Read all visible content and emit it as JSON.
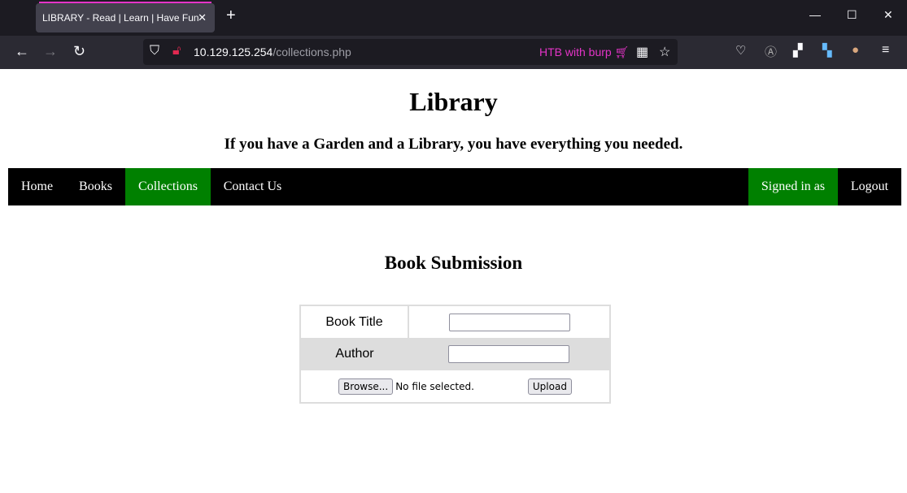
{
  "browser": {
    "tab_title": "LIBRARY - Read | Learn | Have Fun",
    "url_host": "10.129.125.254",
    "url_path": "/collections.php",
    "extension_label": "HTB with burp"
  },
  "header": {
    "title": "Library",
    "subtitle": "If you have a Garden and a Library, you have everything you needed."
  },
  "nav": {
    "items": [
      "Home",
      "Books",
      "Collections",
      "Contact Us"
    ],
    "active": "Collections",
    "signed_in": "Signed in as",
    "logout": "Logout",
    "active_color": "#008000"
  },
  "form": {
    "heading": "Book Submission",
    "book_title_label": "Book Title",
    "author_label": "Author",
    "book_title_value": "",
    "author_value": "",
    "browse_label": "Browse...",
    "no_file": "No file selected.",
    "upload_label": "Upload"
  }
}
